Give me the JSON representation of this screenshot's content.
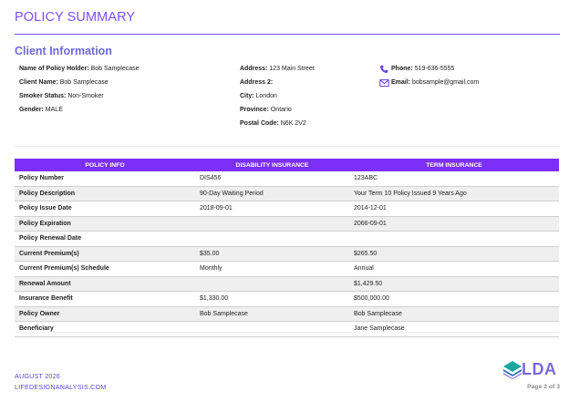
{
  "header": {
    "title": "POLICY SUMMARY"
  },
  "client": {
    "heading": "Client Information",
    "col1": [
      {
        "label": "Name of Policy Holder:",
        "value": "Bob Samplecase"
      },
      {
        "label": "Client Name:",
        "value": "Bob Samplecase"
      },
      {
        "label": "Smoker Status:",
        "value": "Non-Smoker"
      },
      {
        "label": "Gender:",
        "value": "MALE"
      }
    ],
    "col2": [
      {
        "label": "Address:",
        "value": "123 Main Street"
      },
      {
        "label": "Address 2:",
        "value": ""
      },
      {
        "label": "City:",
        "value": "London"
      },
      {
        "label": "Province:",
        "value": "Ontario"
      },
      {
        "label": "Postal Code:",
        "value": "N6K 2V2"
      }
    ],
    "contact": {
      "phone_label": "Phone:",
      "phone_value": "519-636-5555",
      "email_label": "Email:",
      "email_value": "bobsample@gmail.com",
      "phone_icon": "phone-icon",
      "email_icon": "envelope-icon"
    }
  },
  "table": {
    "headers": [
      "POLICY INFO",
      "DISABILITY INSURANCE",
      "TERM INSURANCE"
    ],
    "rows": [
      [
        "Policy Number",
        "DIS456",
        "123ABC"
      ],
      [
        "Policy Description",
        "90-Day Waiting Period",
        "Your Term 10 Policy Issued 9 Years Ago"
      ],
      [
        "Policy Issue Date",
        "2018-09-01",
        "2014-12-01"
      ],
      [
        "Policy Expiration",
        "",
        "2066-09-01"
      ],
      [
        "Policy Renewal Date",
        "",
        ""
      ],
      [
        "Current Premium(s)",
        "$35.00",
        "$265.50"
      ],
      [
        "Current Premium(s) Schedule",
        "Monthly",
        "Annual"
      ],
      [
        "Renewal Amount",
        "",
        "$1,429.50"
      ],
      [
        "Insurance Benefit",
        "$1,330.00",
        "$500,000.00"
      ],
      [
        "Policy Owner",
        "Bob Samplecase",
        "Bob Samplecase"
      ],
      [
        "Beneficiary",
        "",
        "Jane Samplecase"
      ]
    ]
  },
  "footer": {
    "date": "AUGUST 2026",
    "website": "LIFEDESIGNANALYSIS.COM",
    "logo_text": "LDA",
    "page": "Page 2 of 3"
  },
  "colors": {
    "accent": "#7b2ff7",
    "heading": "#6f6ad6",
    "logo_teal": "#1fa5a0"
  }
}
